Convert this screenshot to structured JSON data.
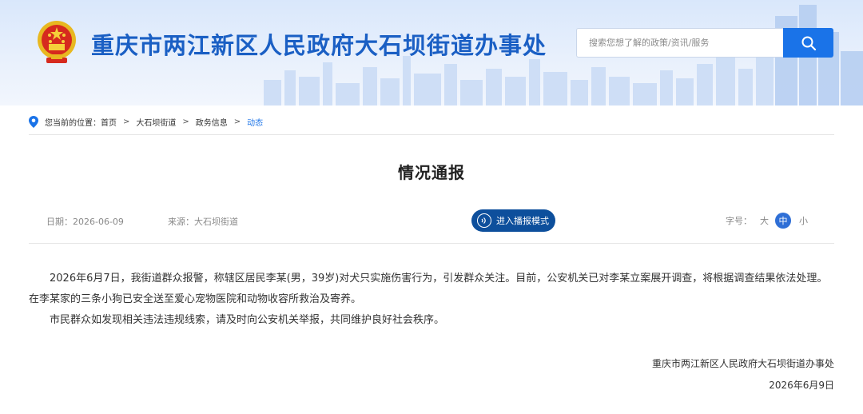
{
  "header": {
    "site_title": "重庆市两江新区人民政府大石坝街道办事处",
    "search": {
      "placeholder": "搜索您想了解的政策/资讯/服务",
      "value": ""
    }
  },
  "icons": {
    "emblem": "national-emblem-icon",
    "search": "search-icon",
    "location": "location-pin-icon",
    "broadcast": "audio-broadcast-icon"
  },
  "breadcrumb": {
    "prefix": "您当前的位置：",
    "items": [
      "首页",
      "大石坝街道",
      "政务信息",
      "动态"
    ],
    "separator": ">"
  },
  "article": {
    "title": "情况通报",
    "date": "日期：2026-06-09",
    "source": "来源：大石坝街道",
    "broadcast_label": "进入播报模式",
    "font_size_label": "字号：",
    "font_sizes": [
      "大",
      "中",
      "小"
    ],
    "font_size_selected": "中",
    "paragraphs": [
      "2026年6月7日，我街道群众报警，称辖区居民李某(男，39岁)对犬只实施伤害行为，引发群众关注。目前，公安机关已对李某立案展开调查，将根据调查结果依法处理。在李某家的三条小狗已安全送至爱心宠物医院和动物收容所救治及寄养。",
      "市民群众如发现相关违法违规线索，请及时向公安机关举报，共同维护良好社会秩序。"
    ],
    "signature_org": "重庆市两江新区人民政府大石坝街道办事处",
    "signature_date": "2026年6月9日"
  },
  "colors": {
    "brand_blue": "#1a5fc4",
    "accent_blue": "#1a73e8",
    "broadcast_bg": "#0d4f9c"
  }
}
